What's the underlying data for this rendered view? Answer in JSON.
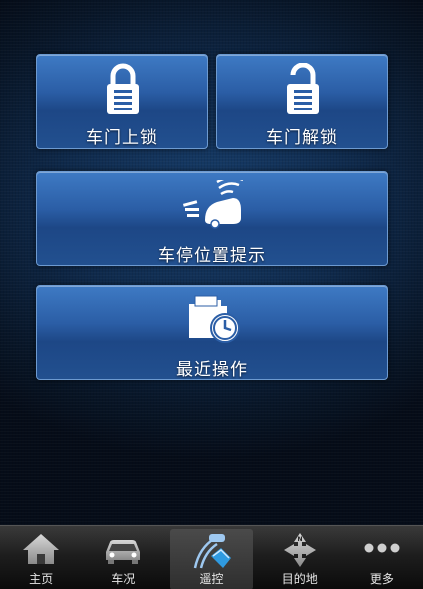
{
  "actions": {
    "lock": {
      "label": "车门上锁",
      "icon": "padlock-locked-icon"
    },
    "unlock": {
      "label": "车门解锁",
      "icon": "padlock-unlocked-icon"
    },
    "locate": {
      "label": "车停位置提示",
      "icon": "car-alert-icon"
    },
    "history": {
      "label": "最近操作",
      "icon": "folder-clock-icon"
    }
  },
  "tabs": [
    {
      "label": "主页",
      "icon": "home-icon",
      "active": false
    },
    {
      "label": "车况",
      "icon": "car-icon",
      "active": false
    },
    {
      "label": "遥控",
      "icon": "remote-control-icon",
      "active": true
    },
    {
      "label": "目的地",
      "icon": "navigation-icon",
      "active": false
    },
    {
      "label": "更多",
      "icon": "more-dots-icon",
      "active": false
    }
  ],
  "colors": {
    "tile_top": "#3e7ac4",
    "tile_bottom": "#1d4786",
    "tile_border": "#6d9ad0",
    "tabbar": "#1e1e1e"
  }
}
